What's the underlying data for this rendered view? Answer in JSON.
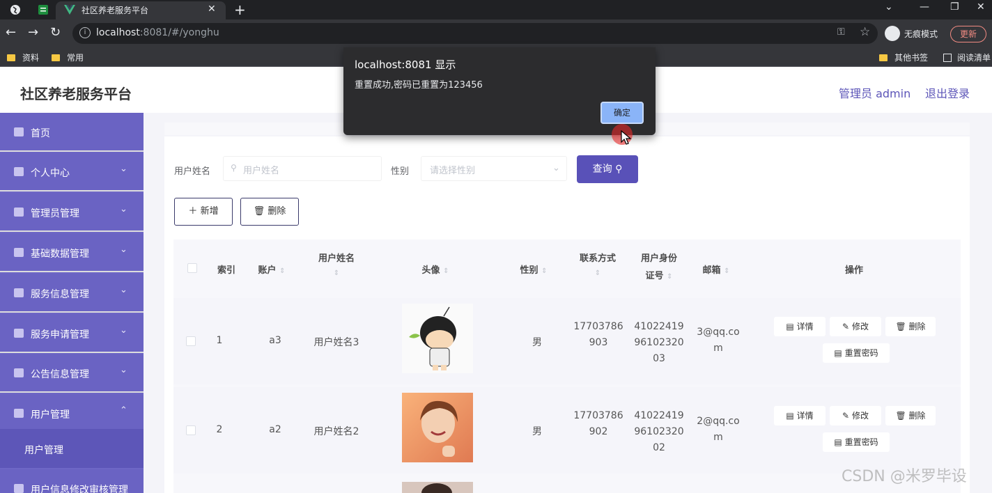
{
  "browser": {
    "tab_title": "社区养老服务平台",
    "url_host": "localhost",
    "url_rest": ":8081/#/yonghu",
    "incognito_label": "无痕模式",
    "update_label": "更新",
    "bookmarks": [
      "资料",
      "常用",
      "其他书签",
      "阅读清单"
    ]
  },
  "dialog": {
    "title": "localhost:8081 显示",
    "message": "重置成功,密码已重置为123456",
    "ok_label": "确定"
  },
  "header": {
    "title": "社区养老服务平台",
    "admin_label": "管理员 admin",
    "logout_label": "退出登录"
  },
  "sidebar": {
    "items": [
      {
        "label": "首页",
        "icon": "home-icon"
      },
      {
        "label": "个人中心",
        "icon": "user-icon"
      },
      {
        "label": "管理员管理",
        "icon": "admin-icon"
      },
      {
        "label": "基础数据管理",
        "icon": "list-icon"
      },
      {
        "label": "服务信息管理",
        "icon": "service-icon"
      },
      {
        "label": "服务申请管理",
        "icon": "apply-icon"
      },
      {
        "label": "公告信息管理",
        "icon": "notice-icon"
      },
      {
        "label": "用户管理",
        "icon": "users-icon"
      },
      {
        "label": "用户信息修改审核管理",
        "icon": "audit-icon"
      }
    ],
    "submenu_label": "用户管理"
  },
  "search": {
    "name_label": "用户姓名",
    "name_placeholder": "用户姓名",
    "gender_label": "性别",
    "gender_placeholder": "请选择性别",
    "query_label": "查询"
  },
  "actions": {
    "add_label": "新增",
    "delete_label": "删除"
  },
  "table": {
    "columns": {
      "index": "索引",
      "account": "账户",
      "name_line1": "用户姓名",
      "avatar": "头像",
      "gender": "性别",
      "phone_line1": "联系方式",
      "idcard_line1": "用户身份",
      "idcard_line2": "证号",
      "email": "邮箱",
      "ops": "操作"
    },
    "rows": [
      {
        "index": "1",
        "account": "a3",
        "name": "用户姓名3",
        "gender": "男",
        "phone_a": "17703786",
        "phone_b": "903",
        "id_a": "41022419",
        "id_b": "96102320",
        "id_c": "03",
        "email_a": "3@qq.co",
        "email_b": "m"
      },
      {
        "index": "2",
        "account": "a2",
        "name": "用户姓名2",
        "gender": "男",
        "phone_a": "17703786",
        "phone_b": "902",
        "id_a": "41022419",
        "id_b": "96102320",
        "id_c": "02",
        "email_a": "2@qq.co",
        "email_b": "m"
      }
    ],
    "op_labels": {
      "detail": "详情",
      "edit": "修改",
      "delete": "删除",
      "reset": "重置密码"
    }
  },
  "watermark": "CSDN @米罗毕设"
}
